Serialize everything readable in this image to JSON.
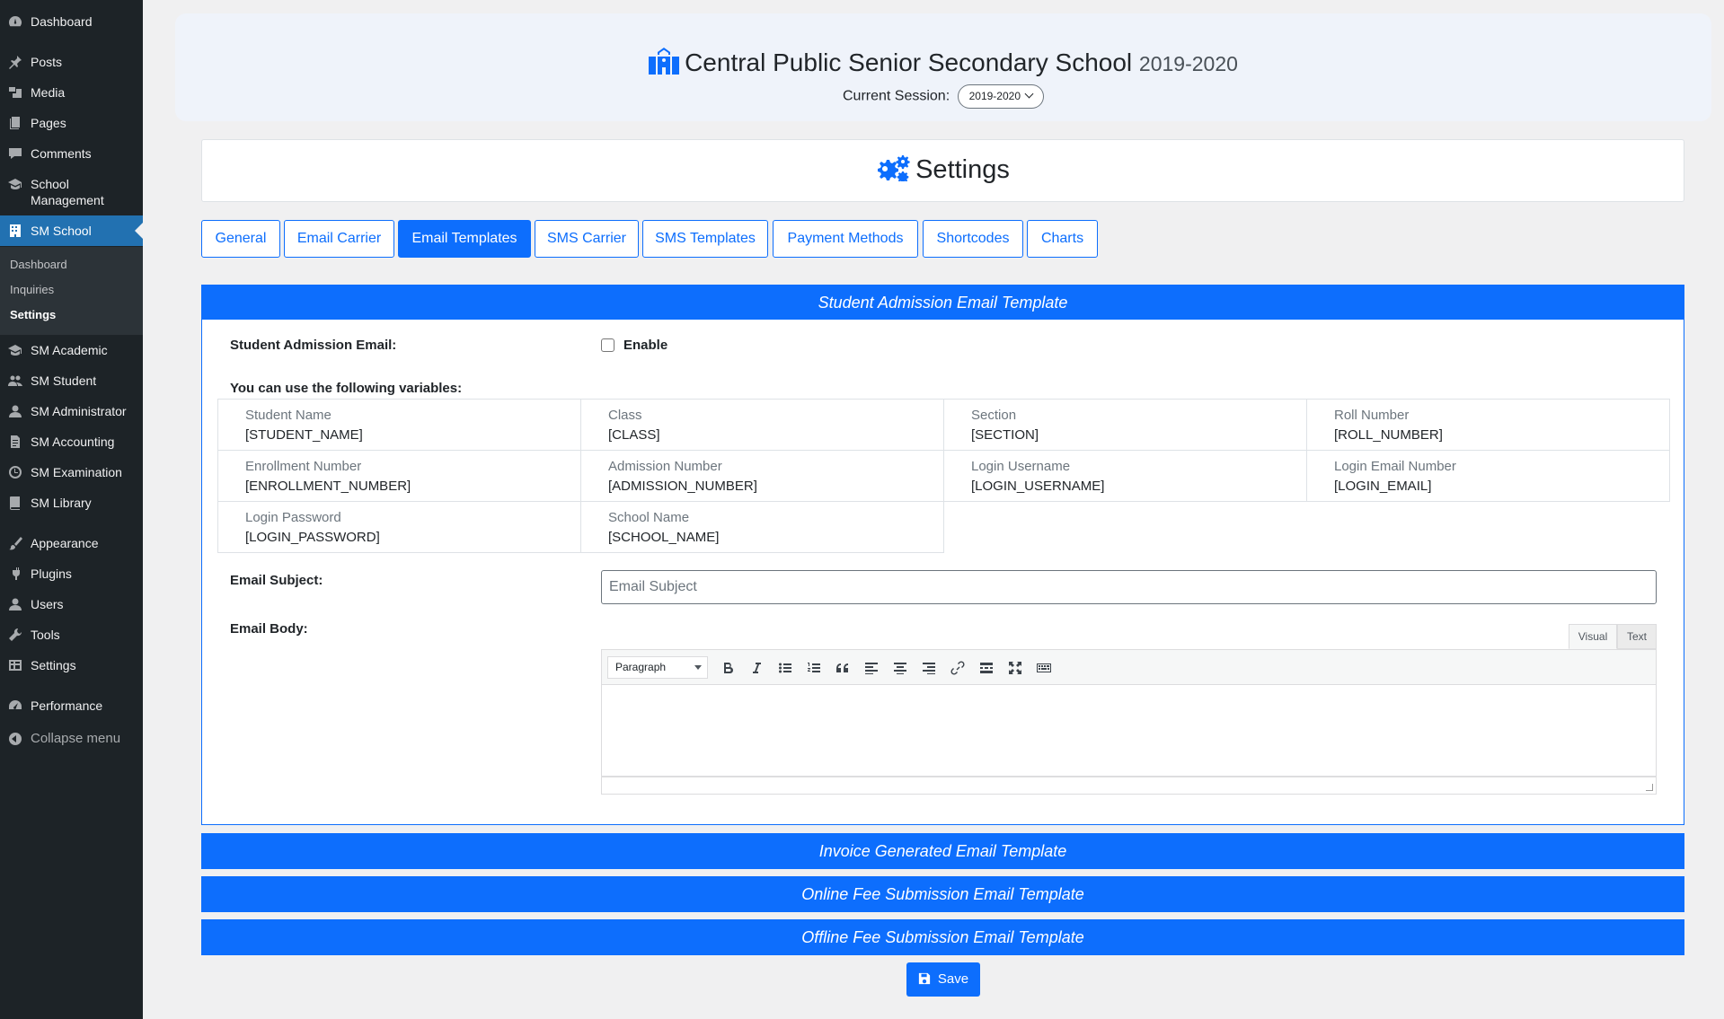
{
  "sidebar": {
    "items": [
      {
        "label": "Dashboard",
        "icon": "dashboard-icon"
      },
      {
        "label": "Posts",
        "icon": "pin-icon"
      },
      {
        "label": "Media",
        "icon": "media-icon"
      },
      {
        "label": "Pages",
        "icon": "pages-icon"
      },
      {
        "label": "Comments",
        "icon": "comment-icon"
      },
      {
        "label": "School Management",
        "icon": "graduation-cap-icon"
      },
      {
        "label": "SM School",
        "icon": "building-icon"
      },
      {
        "label": "SM Academic",
        "icon": "graduation-cap-icon"
      },
      {
        "label": "SM Student",
        "icon": "students-icon"
      },
      {
        "label": "SM Administrator",
        "icon": "user-icon"
      },
      {
        "label": "SM Accounting",
        "icon": "document-icon"
      },
      {
        "label": "SM Examination",
        "icon": "clock-icon"
      },
      {
        "label": "SM Library",
        "icon": "book-icon"
      },
      {
        "label": "Appearance",
        "icon": "brush-icon"
      },
      {
        "label": "Plugins",
        "icon": "plug-icon"
      },
      {
        "label": "Users",
        "icon": "user-icon"
      },
      {
        "label": "Tools",
        "icon": "wrench-icon"
      },
      {
        "label": "Settings",
        "icon": "settings-icon"
      },
      {
        "label": "Performance",
        "icon": "gauge-icon"
      }
    ],
    "submenu": [
      "Dashboard",
      "Inquiries",
      "Settings"
    ],
    "collapse_label": "Collapse menu"
  },
  "header": {
    "school_name": "Central Public Senior Secondary School",
    "year": "2019-2020",
    "session_label": "Current Session:",
    "session_value": "2019-2020"
  },
  "settings_title": "Settings",
  "tabs": [
    "General",
    "Email Carrier",
    "Email Templates",
    "SMS Carrier",
    "SMS Templates",
    "Payment Methods",
    "Shortcodes",
    "Charts"
  ],
  "active_tab": "Email Templates",
  "panel": {
    "title": "Student Admission Email Template",
    "admission_email_label": "Student Admission Email:",
    "enable_label": "Enable",
    "variables_intro": "You can use the following variables:",
    "variables": [
      {
        "name": "Student Name",
        "code": "[STUDENT_NAME]"
      },
      {
        "name": "Class",
        "code": "[CLASS]"
      },
      {
        "name": "Section",
        "code": "[SECTION]"
      },
      {
        "name": "Roll Number",
        "code": "[ROLL_NUMBER]"
      },
      {
        "name": "Enrollment Number",
        "code": "[ENROLLMENT_NUMBER]"
      },
      {
        "name": "Admission Number",
        "code": "[ADMISSION_NUMBER]"
      },
      {
        "name": "Login Username",
        "code": "[LOGIN_USERNAME]"
      },
      {
        "name": "Login Email Number",
        "code": "[LOGIN_EMAIL]"
      },
      {
        "name": "Login Password",
        "code": "[LOGIN_PASSWORD]"
      },
      {
        "name": "School Name",
        "code": "[SCHOOL_NAME]"
      }
    ],
    "subject_label": "Email Subject:",
    "subject_placeholder": "Email Subject",
    "body_label": "Email Body:",
    "editor": {
      "visual_tab": "Visual",
      "text_tab": "Text",
      "format": "Paragraph"
    }
  },
  "other_templates": [
    "Invoice Generated Email Template",
    "Online Fee Submission Email Template",
    "Offline Fee Submission Email Template"
  ],
  "save_label": "Save",
  "colors": {
    "primary": "#0d6efd",
    "sidebar": "#1d2327",
    "sidebar_current": "#2271b1"
  }
}
